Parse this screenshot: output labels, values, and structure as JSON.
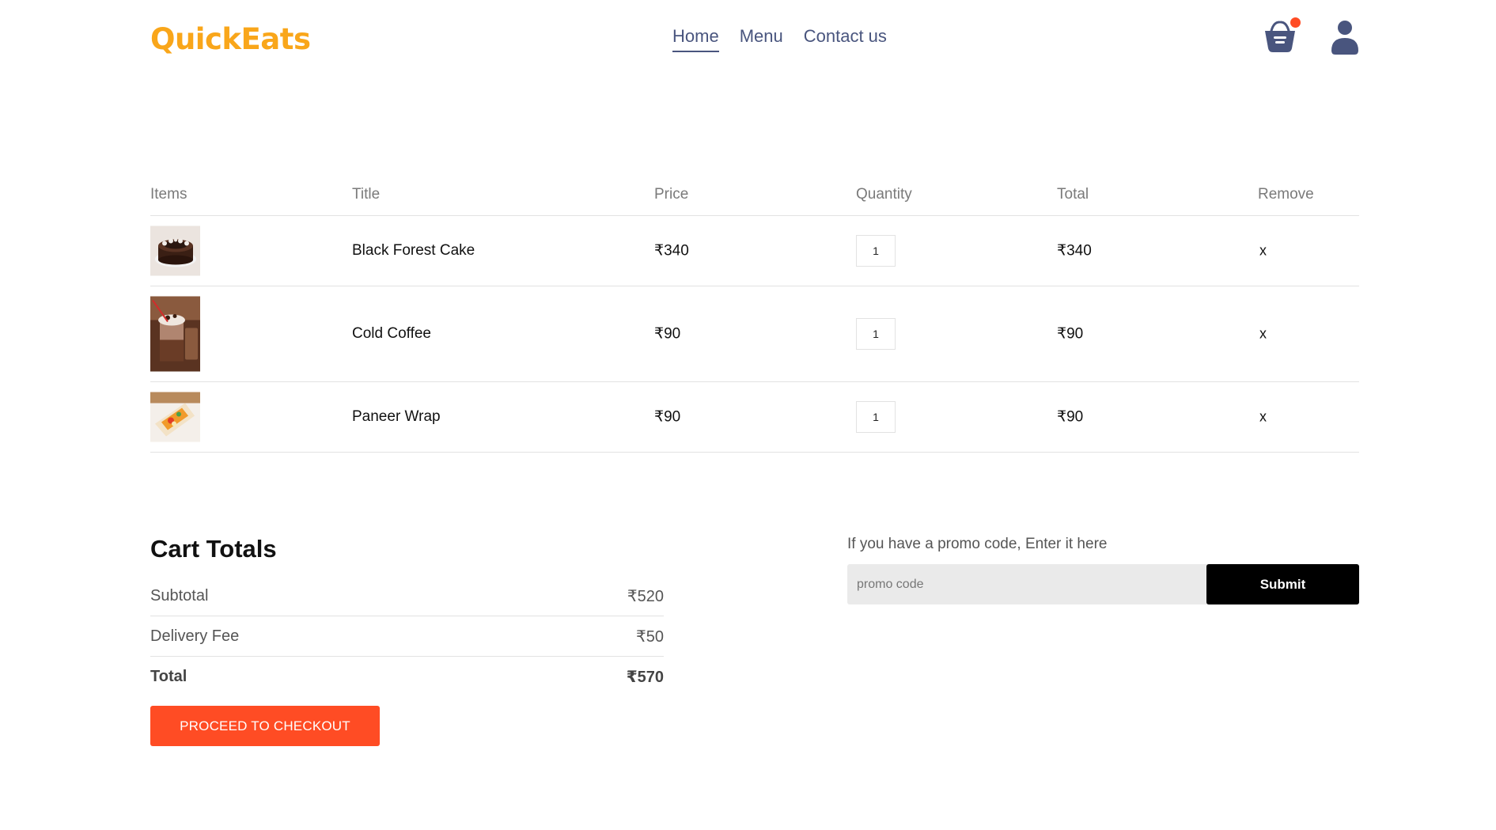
{
  "navbar": {
    "logo": "QuickEats",
    "links": [
      {
        "label": "Home",
        "active": true
      },
      {
        "label": "Menu",
        "active": false
      },
      {
        "label": "Contact us",
        "active": false
      }
    ],
    "basket_icon": "basket-icon",
    "profile_icon": "profile-icon",
    "colors": {
      "logo": "#f9a61a",
      "nav": "#49557e",
      "badge": "#ff4c24"
    }
  },
  "cart": {
    "headers": {
      "items": "Items",
      "title": "Title",
      "price": "Price",
      "quantity": "Quantity",
      "total": "Total",
      "remove": "Remove"
    },
    "rows": [
      {
        "image": "black-forest-cake-image",
        "title": "Black Forest Cake",
        "price": "₹340",
        "quantity": "1",
        "total": "₹340",
        "remove": "x"
      },
      {
        "image": "cold-coffee-image",
        "title": "Cold Coffee",
        "price": "₹90",
        "quantity": "1",
        "total": "₹90",
        "remove": "x"
      },
      {
        "image": "paneer-wrap-image",
        "title": "Paneer Wrap",
        "price": "₹90",
        "quantity": "1",
        "total": "₹90",
        "remove": "x"
      }
    ]
  },
  "totals": {
    "title": "Cart Totals",
    "subtotal_label": "Subtotal",
    "subtotal_value": "₹520",
    "delivery_label": "Delivery Fee",
    "delivery_value": "₹50",
    "total_label": "Total",
    "total_value": "₹570",
    "checkout_label": "PROCEED TO CHECKOUT",
    "checkout_color": "#ff4c24"
  },
  "promo": {
    "text": "If you have a promo code, Enter it here",
    "placeholder": "promo code",
    "submit_label": "Submit"
  }
}
